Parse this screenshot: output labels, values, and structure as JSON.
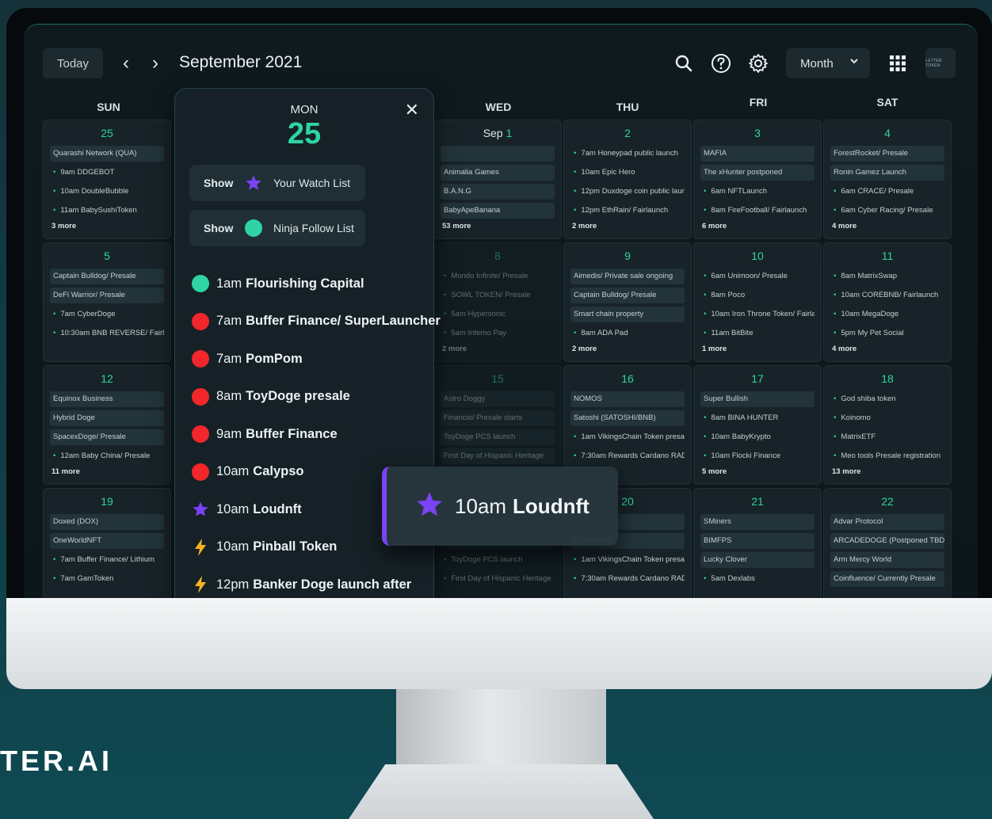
{
  "brand_text": "TER.AI",
  "header": {
    "today_label": "Today",
    "prev": "‹",
    "next": "›",
    "month_title": "September 2021",
    "view_label": "Month",
    "brand_badge": "LETTER TOKEN"
  },
  "days_of_week": [
    "SUN",
    "MON",
    "WED",
    "THU",
    "FRI",
    "SAT"
  ],
  "weeks": [
    {
      "cells": [
        {
          "num": "25",
          "events": [
            {
              "t": "Quarashi Network (QUA)",
              "s": "box"
            },
            {
              "t": "9am DDGEBOT",
              "s": "dot"
            },
            {
              "t": "10am DoubleBubble",
              "s": "dot"
            },
            {
              "t": "11am BabySushiToken",
              "s": "dot"
            }
          ],
          "more": "3 more"
        },
        {
          "num": "1",
          "prefix": "Sep ",
          "dim": false,
          "events": [
            {
              "t": "",
              "s": "box"
            },
            {
              "t": "Animalia Games",
              "s": "box"
            },
            {
              "t": "B.A.N.G",
              "s": "box"
            },
            {
              "t": "BabyApeBanana",
              "s": "box"
            }
          ],
          "more": "53 more"
        },
        {
          "num": "2",
          "events": [
            {
              "t": "7am Honeypad public launch",
              "s": "dot"
            },
            {
              "t": "10am Epic Hero",
              "s": "dot"
            },
            {
              "t": "12pm Duxdoge coin public launch",
              "s": "dot"
            },
            {
              "t": "12pm EthRain/ Fairlaunch",
              "s": "dot"
            }
          ],
          "more": "2 more"
        },
        {
          "num": "3",
          "events": [
            {
              "t": "MAFIA",
              "s": "box"
            },
            {
              "t": "The xHunter postponed",
              "s": "box"
            },
            {
              "t": "6am NFTLaunch",
              "s": "dot"
            },
            {
              "t": "8am FireFootball/ Fairlaunch",
              "s": "dot"
            }
          ],
          "more": "6 more"
        },
        {
          "num": "4",
          "events": [
            {
              "t": "ForestRocket/ Presale",
              "s": "box"
            },
            {
              "t": "Ronin Gamez Launch",
              "s": "box"
            },
            {
              "t": "6am CRACE/ Presale",
              "s": "dot"
            },
            {
              "t": "6am Cyber Racing/ Presale",
              "s": "dot"
            }
          ],
          "more": "4 more"
        }
      ]
    },
    {
      "cells": [
        {
          "num": "5",
          "events": [
            {
              "t": "Captain Bulldog/ Presale",
              "s": "box"
            },
            {
              "t": "DeFi Warrior/ Presale",
              "s": "box"
            },
            {
              "t": "7am CyberDoge",
              "s": "dot"
            },
            {
              "t": "10:30am BNB REVERSE/ Fairl",
              "s": "dot"
            }
          ],
          "more": ""
        },
        {
          "num": "8",
          "dim": true,
          "events": [
            {
              "t": "Mondo Infinite/ Presale",
              "s": "dot"
            },
            {
              "t": "SOWL TOKEN/ Presale",
              "s": "dot"
            },
            {
              "t": "5am Hypersonic",
              "s": "dot"
            },
            {
              "t": "5am Inferno Pay",
              "s": "dot"
            }
          ],
          "more": "2 more"
        },
        {
          "num": "9",
          "events": [
            {
              "t": "Aimedis/ Private sale ongoing",
              "s": "box"
            },
            {
              "t": "Captain Bulldog/ Presale",
              "s": "box"
            },
            {
              "t": "Smart chain property",
              "s": "box"
            },
            {
              "t": "8am ADA Pad",
              "s": "dot"
            }
          ],
          "more": "2 more"
        },
        {
          "num": "10",
          "events": [
            {
              "t": "6am Unimoon/ Presale",
              "s": "dot"
            },
            {
              "t": "8am Poco",
              "s": "dot"
            },
            {
              "t": "10am Iron Throne Token/ Fairlaunch",
              "s": "dot"
            },
            {
              "t": "11am BitBite",
              "s": "dot"
            }
          ],
          "more": "1 more"
        },
        {
          "num": "11",
          "events": [
            {
              "t": "8am MatrixSwap",
              "s": "dot"
            },
            {
              "t": "10am COREBNB/ Fairlaunch",
              "s": "dot"
            },
            {
              "t": "10am MegaDoge",
              "s": "dot"
            },
            {
              "t": "5pm My Pet Social",
              "s": "dot"
            }
          ],
          "more": "4 more"
        }
      ]
    },
    {
      "cells": [
        {
          "num": "12",
          "events": [
            {
              "t": "Equinox Business",
              "s": "box"
            },
            {
              "t": "Hybrid Doge",
              "s": "box"
            },
            {
              "t": "SpacexDoge/ Presale",
              "s": "box"
            },
            {
              "t": "12am Baby China/ Presale",
              "s": "dot"
            }
          ],
          "more": "11 more"
        },
        {
          "num": "15",
          "dim": true,
          "events": [
            {
              "t": "Astro Doggy",
              "s": "box"
            },
            {
              "t": "Financio/ Presale starts",
              "s": "box"
            },
            {
              "t": "ToyDoge PCS launch",
              "s": "box"
            },
            {
              "t": "First Day of Hispanic Heritage",
              "s": "box"
            }
          ],
          "more": ""
        },
        {
          "num": "16",
          "events": [
            {
              "t": "NOMOS",
              "s": "box"
            },
            {
              "t": "Satoshi (SATOSHI/BNB)",
              "s": "box"
            },
            {
              "t": "1am VikingsChain Token presale",
              "s": "dot"
            },
            {
              "t": "7:30am Rewards Cardano RADA",
              "s": "dot"
            }
          ],
          "more": ""
        },
        {
          "num": "17",
          "events": [
            {
              "t": "Super Bullish",
              "s": "box"
            },
            {
              "t": "8am BINA HUNTER",
              "s": "dot"
            },
            {
              "t": "10am BabyKrypto",
              "s": "dot"
            },
            {
              "t": "10am Flocki Finance",
              "s": "dot"
            }
          ],
          "more": "5 more"
        },
        {
          "num": "18",
          "events": [
            {
              "t": "God shiba token",
              "s": "dot"
            },
            {
              "t": "Koinomo",
              "s": "dot"
            },
            {
              "t": "MatrixETF",
              "s": "dot"
            },
            {
              "t": "Meo tools Presale registration",
              "s": "dot"
            }
          ],
          "more": "13 more"
        }
      ]
    },
    {
      "cells": [
        {
          "num": "19",
          "events": [
            {
              "t": "Doxed (DOX)",
              "s": "box"
            },
            {
              "t": "OneWorldNFT",
              "s": "box"
            },
            {
              "t": "7am Buffer Finance/ Lithium",
              "s": "dot"
            },
            {
              "t": "7am GamToken",
              "s": "dot"
            }
          ],
          "more": ""
        },
        {
          "num": "",
          "dim": true,
          "events": [
            {
              "t": "",
              "s": "box"
            },
            {
              "t": "",
              "s": "box"
            },
            {
              "t": "ToyDoge PCS launch",
              "s": "dot"
            },
            {
              "t": "First Day of Hispanic Heritage",
              "s": "dot"
            }
          ],
          "more": ""
        },
        {
          "num": "20",
          "events": [
            {
              "t": "",
              "s": "box"
            },
            {
              "t": "OSHI/BNB)",
              "s": "box"
            },
            {
              "t": "1am VikingsChain Token presale",
              "s": "dot"
            },
            {
              "t": "7:30am Rewards Cardano RADA",
              "s": "dot"
            }
          ],
          "more": ""
        },
        {
          "num": "21",
          "events": [
            {
              "t": "SMiners",
              "s": "box"
            },
            {
              "t": "BIMFPS",
              "s": "box"
            },
            {
              "t": "Lucky Clover",
              "s": "box"
            },
            {
              "t": "5am Dexlabs",
              "s": "dot"
            }
          ],
          "more": ""
        },
        {
          "num": "22",
          "events": [
            {
              "t": "Advar Protocol",
              "s": "box"
            },
            {
              "t": "ARCADEDOGE (Postponed TBD)",
              "s": "box"
            },
            {
              "t": "Arm Mercy World",
              "s": "box"
            },
            {
              "t": "Coinfluence/ Currently Presale",
              "s": "box"
            }
          ],
          "more": ""
        }
      ]
    }
  ],
  "popup": {
    "day": "MON",
    "date": "25",
    "close": "✕",
    "show_label": "Show",
    "watch_list": "Your Watch List",
    "follow_list": "Ninja Follow List",
    "events": [
      {
        "time": "1am",
        "name": "Flourishing Capital",
        "marker": "green"
      },
      {
        "time": "7am",
        "name": "Buffer Finance/ SuperLauncher",
        "marker": "red"
      },
      {
        "time": "7am",
        "name": "PomPom",
        "marker": "red"
      },
      {
        "time": "8am",
        "name": "ToyDoge presale",
        "marker": "red"
      },
      {
        "time": "9am",
        "name": "Buffer Finance",
        "marker": "red"
      },
      {
        "time": "10am",
        "name": "Calypso",
        "marker": "red"
      },
      {
        "time": "10am",
        "name": "Loudnft",
        "marker": "star"
      },
      {
        "time": "10am",
        "name": "Pinball Token",
        "marker": "bolt"
      },
      {
        "time": "12pm",
        "name": "Banker Doge launch after",
        "marker": "bolt"
      }
    ]
  },
  "tooltip": {
    "time": "10am",
    "name": "Loudnft"
  },
  "colors": {
    "accent": "#2fd3a4",
    "red": "#f2262b",
    "purple": "#7b42f6",
    "bolt": "#f5b323"
  },
  "icons": [
    "search-icon",
    "help-icon",
    "gear-icon",
    "grid-icon",
    "chevron-down-icon",
    "close-icon",
    "star-icon",
    "bolt-icon"
  ]
}
